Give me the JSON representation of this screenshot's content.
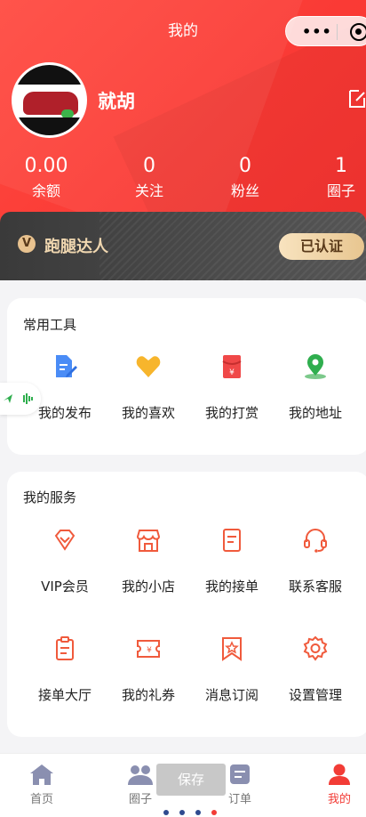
{
  "nav": {
    "title": "我的"
  },
  "profile": {
    "username": "就胡"
  },
  "stats": [
    {
      "value": "0.00",
      "label": "余额"
    },
    {
      "value": "0",
      "label": "关注"
    },
    {
      "value": "0",
      "label": "粉丝"
    },
    {
      "value": "1",
      "label": "圈子"
    }
  ],
  "vip_card": {
    "badge": "V",
    "title": "跑腿达人",
    "status": "已认证"
  },
  "tools": {
    "title": "常用工具",
    "items": [
      {
        "label": "我的发布",
        "icon": "document-edit-icon"
      },
      {
        "label": "我的喜欢",
        "icon": "heart-icon"
      },
      {
        "label": "我的打赏",
        "icon": "red-envelope-icon"
      },
      {
        "label": "我的地址",
        "icon": "location-pin-icon"
      }
    ]
  },
  "services": {
    "title": "我的服务",
    "items": [
      {
        "label": "VIP会员",
        "icon": "diamond-icon"
      },
      {
        "label": "我的小店",
        "icon": "shop-icon"
      },
      {
        "label": "我的接单",
        "icon": "order-sheet-icon"
      },
      {
        "label": "联系客服",
        "icon": "headset-icon"
      },
      {
        "label": "接单大厅",
        "icon": "clipboard-icon"
      },
      {
        "label": "我的礼券",
        "icon": "coupon-icon"
      },
      {
        "label": "消息订阅",
        "icon": "bookmark-star-icon"
      },
      {
        "label": "设置管理",
        "icon": "settings-gear-icon"
      }
    ]
  },
  "tabbar": {
    "items": [
      {
        "label": "首页",
        "icon": "home-icon"
      },
      {
        "label": "圈子",
        "icon": "group-icon"
      },
      {
        "label": "订单",
        "icon": "order-icon"
      },
      {
        "label": "我的",
        "icon": "user-icon",
        "active": true
      }
    ]
  },
  "overlay": {
    "save_label": "保存"
  },
  "colors": {
    "primary": "#f23c36",
    "icon_accent": "#f05a3c",
    "vip_gold": "#e8c28f"
  }
}
